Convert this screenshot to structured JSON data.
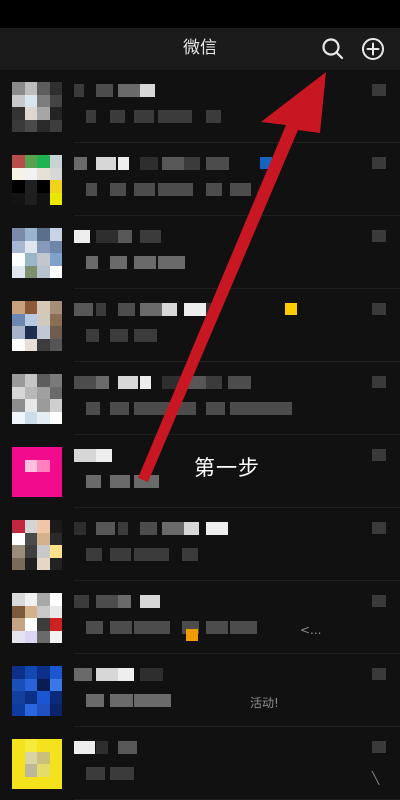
{
  "app": {
    "title": "微信"
  },
  "header": {
    "search_icon": "search-icon",
    "add_icon": "plus-circle-icon"
  },
  "annotation": {
    "label": "第一步",
    "arrow_color": "#c81723"
  },
  "chats": [
    {
      "avatar_colors": [
        "#8b8b8b",
        "#bdbdbd",
        "#5d5d5d",
        "#2f2f2f",
        "#c9c9c9",
        "#d9e6ef",
        "#7d7d7d",
        "#444444",
        "#333333",
        "#ded7d2",
        "#a6a6a6",
        "#242424",
        "#3a3a3a",
        "#4a4a4a",
        "#2a2a2a",
        "#3d3d3d"
      ],
      "name_blocks": 4,
      "msg_blocks": 6,
      "preview": ""
    },
    {
      "avatar_colors": [
        "#b84d4d",
        "#5aa14f",
        "#1fb253",
        "#c7d3d4",
        "#f7f3e4",
        "#f2f2f2",
        "#e7e1d5",
        "#d7d7d7",
        "#000000",
        "#202020",
        "#000000",
        "#f1d21b",
        "#131313",
        "#1f1f1f",
        "#111111",
        "#e9e900"
      ],
      "name_blocks": 7,
      "msg_blocks": 7,
      "preview": "",
      "badge_color": "#1565c0"
    },
    {
      "avatar_colors": [
        "#7a8aa8",
        "#9ab3ce",
        "#5c6f8a",
        "#c8d4e6",
        "#a7b7d1",
        "#dfe6ef",
        "#8699b8",
        "#6f86a9",
        "#ffffff",
        "#9bb7c7",
        "#c1c7cc",
        "#80a1c9",
        "#e0e6f0",
        "#7d8f6e",
        "#b8c3cf",
        "#ffffff"
      ],
      "name_blocks": 4,
      "msg_blocks": 4,
      "preview": ""
    },
    {
      "avatar_colors": [
        "#c9a27d",
        "#8c5a3b",
        "#d6c8b7",
        "#a58d7a",
        "#6d88b0",
        "#b7c9e3",
        "#d0c9bd",
        "#8b6e56",
        "#a7b3c8",
        "#1f2f4f",
        "#bfc8d4",
        "#6e5c4f",
        "#ffffff",
        "#e8e0d8",
        "#3c3c3c",
        "#555555"
      ],
      "name_blocks": 7,
      "msg_blocks": 3,
      "preview": "",
      "badge_color": "#ffcc00"
    },
    {
      "avatar_colors": [
        "#9a9a9a",
        "#c6c6c6",
        "#5d5d5d",
        "#7b7b7b",
        "#d7d7d7",
        "#b8b8b8",
        "#a0a0a0",
        "#6a6a6a",
        "#8e8e8e",
        "#e7e7e7",
        "#9b9b9b",
        "#cfcfcf",
        "#f0f6fb",
        "#ccdde8",
        "#e3edf2",
        "#ffffff"
      ],
      "name_blocks": 8,
      "msg_blocks": 9,
      "preview": ""
    },
    {
      "avatar_colors": [
        "#f20b8d",
        "#f20b8d",
        "#f20b8d",
        "#f20b8d",
        "#f20b8d",
        "#ffbfdf",
        "#ff7fbf",
        "#f20b8d",
        "#f20b8d",
        "#f20b8d",
        "#f20b8d",
        "#f20b8d",
        "#f20b8d",
        "#f20b8d",
        "#f20b8d",
        "#f20b8d"
      ],
      "name_blocks": 2,
      "msg_blocks": 3,
      "preview": ""
    },
    {
      "avatar_colors": [
        "#c02840",
        "#d5d5d5",
        "#f1c6a8",
        "#1b1b1b",
        "#ffffff",
        "#4b4b4b",
        "#d3b28c",
        "#2a2a2a",
        "#9b8b7b",
        "#3f3f3f",
        "#c9c9c9",
        "#ffe08a",
        "#7a6a5a",
        "#1f1f1f",
        "#e6d6c6",
        "#222222"
      ],
      "name_blocks": 7,
      "msg_blocks": 5,
      "preview": ""
    },
    {
      "avatar_colors": [
        "#d9d9d9",
        "#f2f2f2",
        "#a8a8a8",
        "#ffffff",
        "#7a5a3a",
        "#d3b28c",
        "#c9c9c9",
        "#e9e9e9",
        "#c4a484",
        "#ffffff",
        "#3c3c3c",
        "#cc2222",
        "#e4e4ee",
        "#ddd6f3",
        "#6a6a6a",
        "#f2f2f2"
      ],
      "name_blocks": 4,
      "msg_blocks": 7,
      "preview": "<...",
      "badge_color": "#f29900"
    },
    {
      "avatar_colors": [
        "#0c2f88",
        "#1248b0",
        "#0c2f88",
        "#1a56d0",
        "#1a4fb8",
        "#2a62d8",
        "#0a1c55",
        "#3a78e8",
        "#123fa0",
        "#0c2f88",
        "#1a56d0",
        "#0b2a7a",
        "#0d3ba0",
        "#2a66de",
        "#1f4fc0",
        "#0a2468"
      ],
      "name_blocks": 4,
      "msg_blocks": 4,
      "preview": "活动!"
    },
    {
      "avatar_colors": [
        "#f4e21c",
        "#f6ea3a",
        "#f4e21c",
        "#f4e21c",
        "#f4e21c",
        "#d8d4a4",
        "#c9c07f",
        "#f4e21c",
        "#f4e21c",
        "#bcb79a",
        "#e3db6a",
        "#f4e21c",
        "#f4e21c",
        "#f4e21c",
        "#f4e21c",
        "#f4e21c"
      ],
      "name_blocks": 3,
      "msg_blocks": 2,
      "preview": "╲"
    }
  ]
}
